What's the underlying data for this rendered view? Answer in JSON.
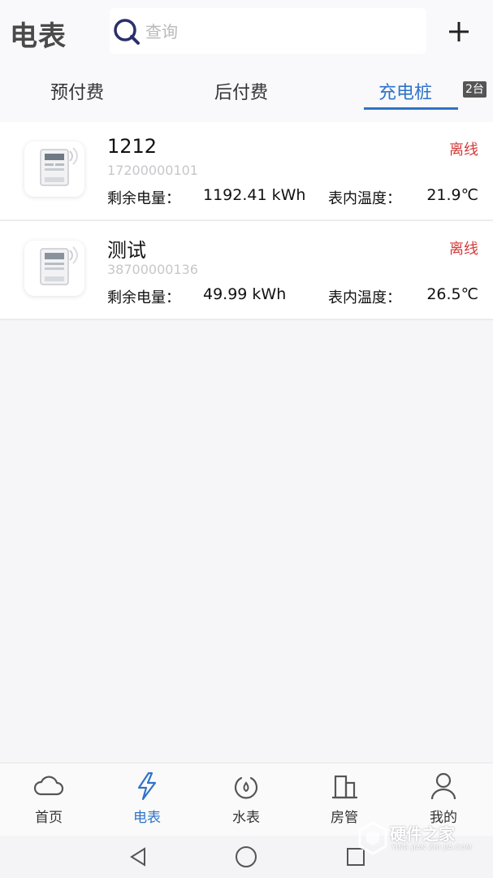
{
  "header": {
    "title": "电表",
    "search_placeholder": "查询",
    "search_icon": "search-icon",
    "add_icon": "plus-icon"
  },
  "tabs": [
    {
      "label": "预付费",
      "active": false
    },
    {
      "label": "后付费",
      "active": false
    },
    {
      "label": "充电桩",
      "active": true,
      "badge": "2台"
    }
  ],
  "meters": [
    {
      "name": "1212",
      "serial": "17200000101",
      "status": "离线",
      "remain_label": "剩余电量：",
      "remain_value": "1192.41 kWh",
      "temp_label": "表内温度：",
      "temp_value": "21.9℃",
      "icon": "electric-meter-icon"
    },
    {
      "name": "测试",
      "serial": "38700000136",
      "status": "离线",
      "remain_label": "剩余电量：",
      "remain_value": "49.99 kWh",
      "temp_label": "表内温度：",
      "temp_value": "26.5℃",
      "icon": "electric-meter-icon"
    }
  ],
  "bottom_nav": [
    {
      "label": "首页",
      "icon": "cloud-icon",
      "active": false
    },
    {
      "label": "电表",
      "icon": "lightning-icon",
      "active": true
    },
    {
      "label": "水表",
      "icon": "water-drop-icon",
      "active": false
    },
    {
      "label": "房管",
      "icon": "building-icon",
      "active": false
    },
    {
      "label": "我的",
      "icon": "user-icon",
      "active": false
    }
  ],
  "system_nav": {
    "back_icon": "back-triangle-icon",
    "home_icon": "home-circle-icon",
    "recents_icon": "recents-square-icon"
  },
  "watermark": {
    "title": "硬件之家",
    "subtitle": "YING JIAN ZHI JIA.COM"
  },
  "colors": {
    "accent": "#2f73c9",
    "status_offline": "#d43a3a",
    "background": "#f6f6f8"
  }
}
